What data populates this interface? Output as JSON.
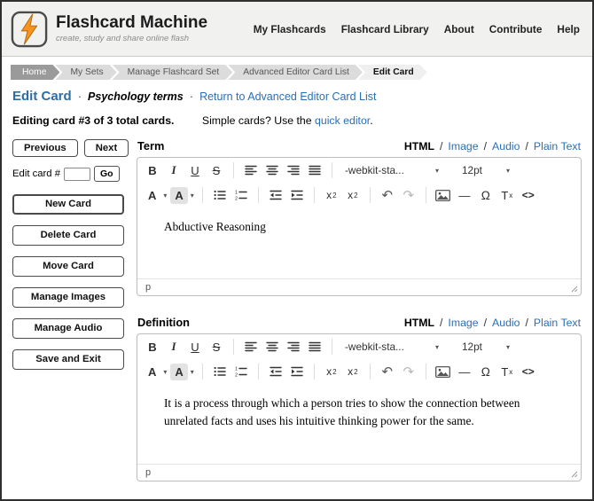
{
  "colors": {
    "accent_blue": "#2a6fb5",
    "title_blue": "#2e6ca4",
    "bolt_orange": "#f7941d"
  },
  "header": {
    "title": "Flashcard Machine",
    "tagline": "create, study and share online flash",
    "nav": [
      {
        "label": "My Flashcards"
      },
      {
        "label": "Flashcard Library"
      },
      {
        "label": "About"
      },
      {
        "label": "Contribute"
      },
      {
        "label": "Help"
      }
    ]
  },
  "breadcrumb": {
    "items": [
      {
        "label": "Home"
      },
      {
        "label": "My Sets"
      },
      {
        "label": "Manage Flashcard Set"
      },
      {
        "label": "Advanced Editor Card List"
      },
      {
        "label": "Edit Card"
      }
    ]
  },
  "page": {
    "title": "Edit Card",
    "separator": "·",
    "set_name": "Psychology terms",
    "return_link": "Return to Advanced Editor Card List",
    "editing_status": "Editing card #3 of 3 total cards.",
    "simple_prompt": "Simple cards? Use the",
    "quick_editor_link": "quick editor",
    "sentence_end": "."
  },
  "sidebar": {
    "previous": "Previous",
    "next": "Next",
    "edit_card_label": "Edit card #",
    "edit_card_value": "",
    "go": "Go",
    "buttons": [
      {
        "label": "New Card"
      },
      {
        "label": "Delete Card"
      },
      {
        "label": "Move Card"
      },
      {
        "label": "Manage Images"
      },
      {
        "label": "Manage Audio"
      },
      {
        "label": "Save and Exit"
      }
    ]
  },
  "toolbar": {
    "bold": "B",
    "italic": "I",
    "underline": "U",
    "strikethrough": "S",
    "font_family": "-webkit-sta...",
    "font_size": "12pt",
    "caret": "▾",
    "forecolor": "A",
    "backcolor": "A",
    "subscript_base": "x",
    "subscript_mark": "2",
    "superscript_base": "x",
    "superscript_mark": "2",
    "undo": "↶",
    "redo": "↷",
    "hr": "—",
    "special_char": "Ω",
    "clear_base": "T",
    "clear_mark": "x",
    "code": "<>"
  },
  "editors": [
    {
      "label": "Term",
      "mode_html": "HTML",
      "mode_sep": "/",
      "mode_image": "Image",
      "mode_audio": "Audio",
      "mode_plain": "Plain Text",
      "content": "Abductive Reasoning",
      "status_path": "p"
    },
    {
      "label": "Definition",
      "mode_html": "HTML",
      "mode_sep": "/",
      "mode_image": "Image",
      "mode_audio": "Audio",
      "mode_plain": "Plain Text",
      "content": "It is a process through which a person tries to show the connection between unrelated facts and uses his intuitive thinking power for the same.",
      "status_path": "p"
    }
  ]
}
